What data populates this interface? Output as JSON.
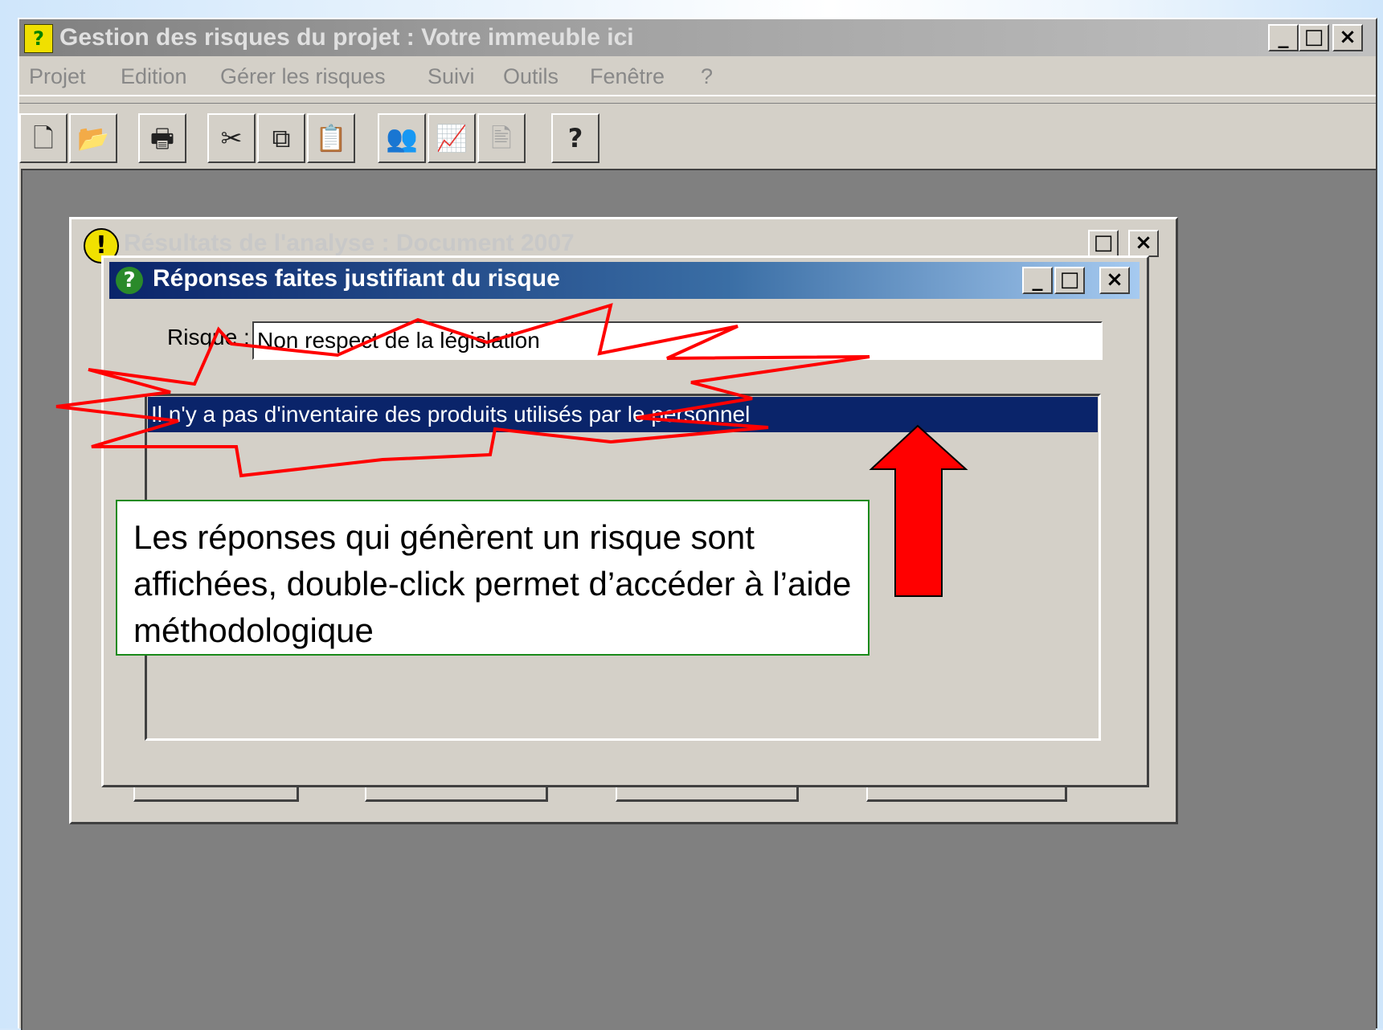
{
  "app": {
    "title": "Gestion des risques du projet : Votre immeuble ici",
    "icon_glyph": "?",
    "window_buttons": {
      "minimize": "_",
      "maximize": "□",
      "close": "×"
    }
  },
  "menu": [
    {
      "label": "Projet"
    },
    {
      "label": "Edition"
    },
    {
      "label": "Gérer les risques"
    },
    {
      "label": "Suivi"
    },
    {
      "label": "Outils"
    },
    {
      "label": "Fenêtre"
    },
    {
      "label": "?"
    }
  ],
  "toolbar": [
    {
      "icon": "new-document-icon",
      "glyph": "🗋"
    },
    {
      "icon": "open-folder-icon",
      "glyph": "📂"
    },
    {
      "icon": "print-icon",
      "glyph": "🖶"
    },
    {
      "icon": "cut-icon",
      "glyph": "✂"
    },
    {
      "icon": "copy-icon",
      "glyph": "⧉"
    },
    {
      "icon": "paste-icon",
      "glyph": "📋"
    },
    {
      "icon": "people-icon",
      "glyph": "👥"
    },
    {
      "icon": "chart-icon",
      "glyph": "📈"
    },
    {
      "icon": "report-icon",
      "glyph": "🖹"
    },
    {
      "icon": "help-icon",
      "glyph": "?"
    }
  ],
  "background_window": {
    "title": "Résultats de l'analyse : Document 2007",
    "icon_glyph": "!",
    "max_glyph": "□",
    "close_glyph": "×"
  },
  "dialog": {
    "title": "Réponses faites justifiant du risque",
    "icon_glyph": "?",
    "window_buttons": {
      "minimize": "_",
      "maximize": "□",
      "close": "×"
    },
    "risque_label": "Risque :",
    "risque_value": "Non respect de la législation",
    "answers": [
      "Il n'y a pas d'inventaire des produits utilisés par le personnel"
    ]
  },
  "callout": {
    "text": "Les réponses qui génèrent un risque sont affichées, double-click permet d’accéder à l’aide méthodologique"
  },
  "colors": {
    "highlight": "#0a246a",
    "annotation_red": "#ff0000",
    "callout_border": "#1a8a1a"
  }
}
